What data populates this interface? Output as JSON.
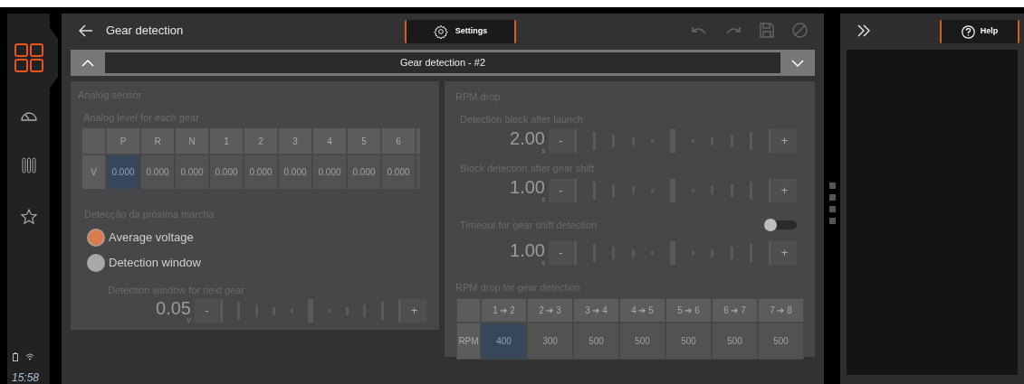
{
  "sidebar": {
    "items": [
      {
        "kind": "apps",
        "selected": true
      },
      {
        "kind": "gauge",
        "selected": false
      },
      {
        "kind": "bars",
        "selected": false
      },
      {
        "kind": "star",
        "selected": false
      }
    ],
    "time": "15:58"
  },
  "header": {
    "title": "Gear detection",
    "settings_button": "Settings"
  },
  "selector": {
    "value": "Gear detection - #2"
  },
  "analog_sensor": {
    "title": "Analog sensor",
    "table": {
      "title": "Analog level for each gear",
      "columns": [
        "P",
        "R",
        "N",
        "1",
        "2",
        "3",
        "4",
        "5",
        "6"
      ],
      "row_label": "V",
      "cells": [
        {
          "value": "0.000",
          "selected": true
        },
        {
          "value": "0.000",
          "selected": false
        },
        {
          "value": "0.000",
          "selected": false
        },
        {
          "value": "0.000",
          "selected": false
        },
        {
          "value": "0.000",
          "selected": false
        },
        {
          "value": "0.000",
          "selected": false
        },
        {
          "value": "0.000",
          "selected": false
        },
        {
          "value": "0.000",
          "selected": false
        },
        {
          "value": "0.000",
          "selected": false
        }
      ]
    },
    "next_gear": {
      "title": "Detecção da próxima marcha",
      "options": [
        {
          "label": "Average voltage",
          "selected": true
        },
        {
          "label": "Detection window",
          "selected": false
        }
      ]
    },
    "window": {
      "label": "Detection window for next gear",
      "value": "0.05",
      "unit": "V",
      "minus": "-",
      "plus": "+"
    }
  },
  "rpm_drop": {
    "title": "RPM drop",
    "settings": [
      {
        "label": "Detection block after launch",
        "value": "2.00",
        "unit": "s",
        "minus": "-",
        "plus": "+"
      },
      {
        "label": "Block detection after gear shift",
        "value": "1.00",
        "unit": "s",
        "minus": "-",
        "plus": "+"
      },
      {
        "label": "Timeout for gear shift detection",
        "value": "1.00",
        "unit": "s",
        "minus": "-",
        "plus": "+",
        "toggle": {
          "on": false
        }
      }
    ],
    "table": {
      "title": "RPM drop for gear detection",
      "columns": [
        "1 ➔ 2",
        "2 ➔ 3",
        "3 ➔ 4",
        "4 ➔ 5",
        "5 ➔ 6",
        "6 ➔ 7",
        "7 ➔ 8"
      ],
      "row_label": "RPM",
      "cells": [
        {
          "value": "400",
          "selected": true
        },
        {
          "value": "300",
          "selected": false
        },
        {
          "value": "500",
          "selected": false
        },
        {
          "value": "500",
          "selected": false
        },
        {
          "value": "500",
          "selected": false
        },
        {
          "value": "500",
          "selected": false
        },
        {
          "value": "500",
          "selected": false
        }
      ]
    }
  },
  "help_panel": {
    "help_button": "Help"
  }
}
